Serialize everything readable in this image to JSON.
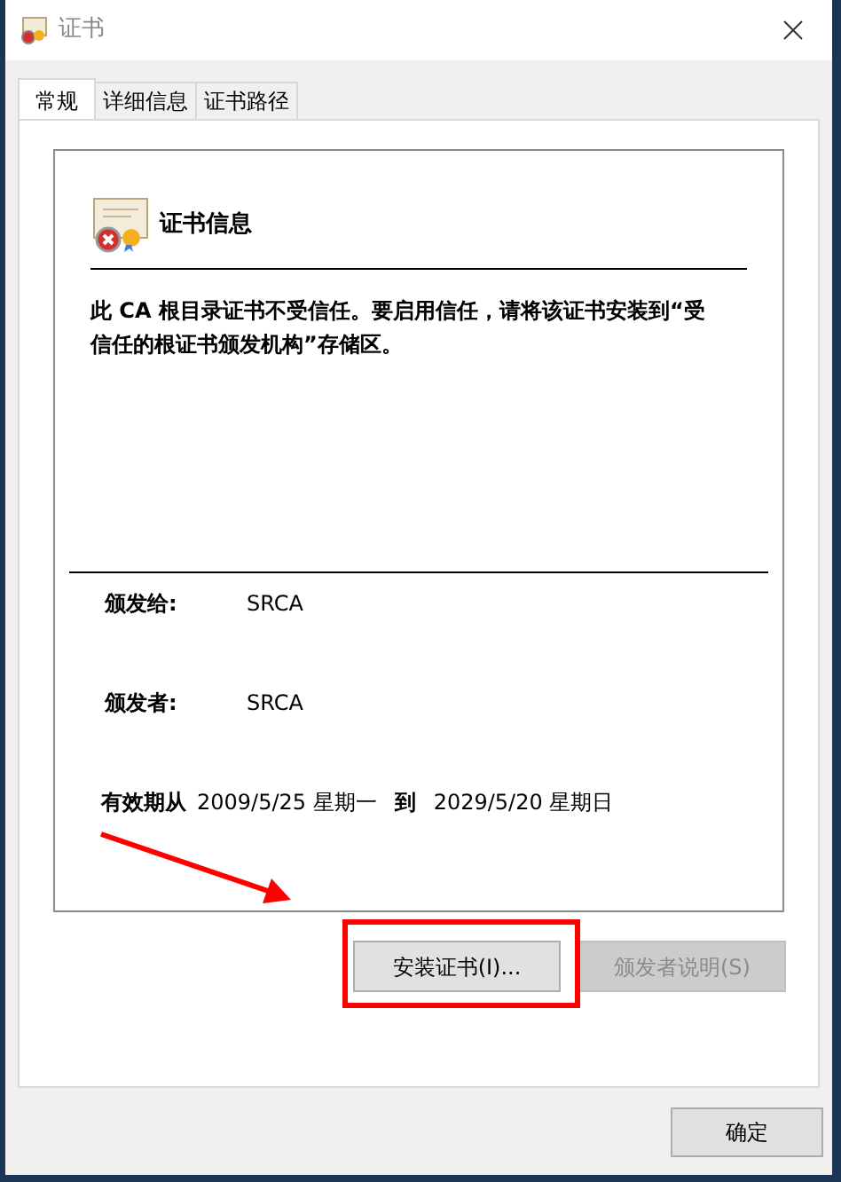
{
  "window": {
    "title": "证书"
  },
  "tabs": [
    {
      "label": "常规",
      "selected": true
    },
    {
      "label": "详细信息",
      "selected": false
    },
    {
      "label": "证书路径",
      "selected": false
    }
  ],
  "heading": "证书信息",
  "message": "此 CA 根目录证书不受信任。要启用信任，请将该证书安装到“受信任的根证书颁发机构”存储区。",
  "issued_to": {
    "label": "颁发给:",
    "value": "SRCA"
  },
  "issued_by": {
    "label": "颁发者:",
    "value": "SRCA"
  },
  "validity": {
    "label": "有效期从",
    "from": "2009/5/25 星期一",
    "to_label": "到",
    "to": "2029/5/20 星期日"
  },
  "buttons": [
    {
      "label": "安装证书(I)...",
      "disabled": false,
      "highlighted": true
    },
    {
      "label": "颁发者说明(S)",
      "disabled": true,
      "highlighted": false
    }
  ],
  "ok_button": {
    "label": "确定"
  }
}
